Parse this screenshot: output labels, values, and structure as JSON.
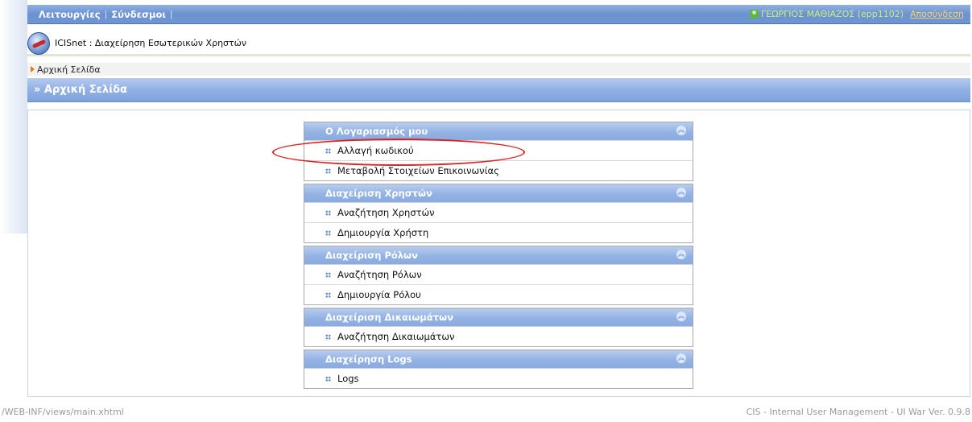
{
  "topbar": {
    "menu_items": [
      "Λειτουργίες",
      "Σύνδεσμοι"
    ],
    "separator": "|",
    "user_name": "ΓΕΩΡΓΙΟΣ ΜΑΘΙΑΖΟΣ (epp1102)",
    "logout": "Αποσύνδεση"
  },
  "app": {
    "title": "ICISnet : Διαχείρηση Εσωτερικών Χρηστών"
  },
  "breadcrumb": {
    "items": [
      "Αρχική Σελίδα"
    ]
  },
  "page": {
    "title": "» Αρχική Σελίδα"
  },
  "panels": [
    {
      "title": "Ο Λογαριασμός μου",
      "items": [
        "Αλλαγή κωδικού",
        "Μεταβολή Στοιχείων Επικοινωνίας"
      ]
    },
    {
      "title": "Διαχείριση Χρηστών",
      "items": [
        "Αναζήτηση Χρηστών",
        "Δημιουργία Χρήστη"
      ]
    },
    {
      "title": "Διαχείριση Ρόλων",
      "items": [
        "Αναζήτηση Ρόλων",
        "Δημιουργία Ρόλου"
      ]
    },
    {
      "title": "Διαχείριση Δικαιωμάτων",
      "items": [
        "Αναζήτηση Δικαιωμάτων"
      ]
    },
    {
      "title": "Διαχείρηση Logs",
      "items": [
        "Logs"
      ]
    }
  ],
  "footer": {
    "path": "/WEB-INF/views/main.xhtml",
    "version": "CIS - Internal User Management - UI War Ver. 0.9.8"
  },
  "colors": {
    "header_blue": "#6d92d0",
    "panel_header": "#93b2e4",
    "user_green": "#c9f07a",
    "logout_orange": "#f7d36a",
    "annotation_red": "#dd2222"
  },
  "icons": [
    "user-icon",
    "app-logo",
    "breadcrumb-arrow-icon",
    "collapse-icon",
    "bullet-icon"
  ]
}
